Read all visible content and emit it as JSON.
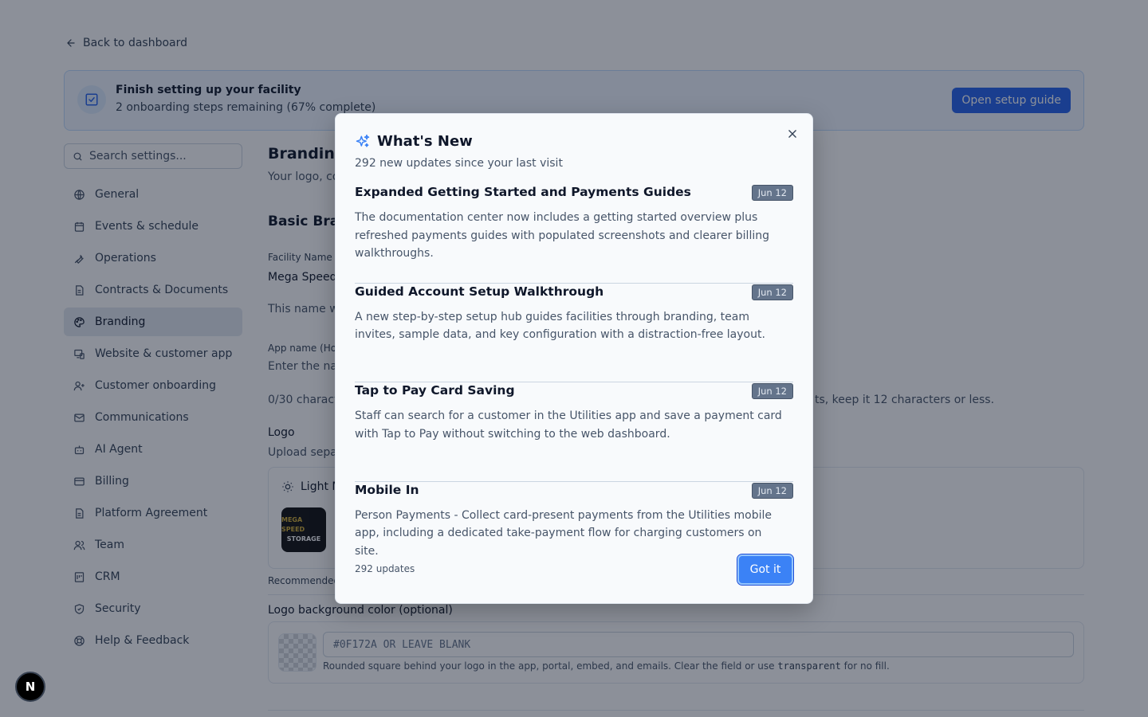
{
  "back_link": "Back to dashboard",
  "setup_banner": {
    "title": "Finish setting up your facility",
    "subtitle": "2 onboarding steps remaining (67% complete)",
    "button": "Open setup guide"
  },
  "search": {
    "placeholder": "Search settings..."
  },
  "sidebar": {
    "items": [
      {
        "label": "General",
        "icon": "globe-icon"
      },
      {
        "label": "Events & schedule",
        "icon": "calendar-icon"
      },
      {
        "label": "Operations",
        "icon": "wrench-icon"
      },
      {
        "label": "Contracts & Documents",
        "icon": "document-icon"
      },
      {
        "label": "Branding",
        "icon": "palette-icon",
        "active": true
      },
      {
        "label": "Website & customer app",
        "icon": "devices-icon"
      },
      {
        "label": "Customer onboarding",
        "icon": "user-plus-icon"
      },
      {
        "label": "Communications",
        "icon": "mail-icon"
      },
      {
        "label": "AI Agent",
        "icon": "bot-icon"
      },
      {
        "label": "Billing",
        "icon": "credit-card-icon"
      },
      {
        "label": "Platform Agreement",
        "icon": "document-icon"
      },
      {
        "label": "Team",
        "icon": "users-icon"
      },
      {
        "label": "CRM",
        "icon": "crm-icon"
      },
      {
        "label": "Security",
        "icon": "shield-icon"
      },
      {
        "label": "Help & Feedback",
        "icon": "lifebuoy-icon"
      }
    ]
  },
  "content": {
    "title": "Branding",
    "subtitle": "Your logo, co",
    "section_title": "Basic Bra",
    "facility_name_label": "Facility Name",
    "facility_name_value": "Mega Speed",
    "facility_name_help": "This name w",
    "app_name_label": "App name (Hor",
    "app_name_placeholder": "Enter the nar",
    "char_count": "0/30 characte",
    "char_count_right": "ts, keep it 12 characters or less.",
    "logo_label": "Logo",
    "logo_help": "Upload sepa",
    "logo_mode": "Light M",
    "logo_text_line1": "MEGA SPEED",
    "logo_text_line2": "STORAGE",
    "recommended": "Recommended",
    "bg_color_label": "Logo background color (optional)",
    "bg_color_placeholder": "#0F172A OR LEAVE BLANK",
    "bg_color_help_prefix": "Rounded square behind your logo in the app, portal, embed, and emails. Clear the field or use ",
    "bg_color_help_code": "transparent",
    "bg_color_help_suffix": " for no fill."
  },
  "modal": {
    "title": "What's New",
    "subtitle": "292 new updates since your last visit",
    "updates": [
      {
        "title": "Expanded Getting Started and Payments Guides",
        "date": "Jun 12",
        "body": "The documentation center now includes a getting started overview plus refreshed payments guides with populated screenshots and clearer billing walkthroughs."
      },
      {
        "title": "Guided Account Setup Walkthrough",
        "date": "Jun 12",
        "body": "A new step-by-step setup hub guides facilities through branding, team invites, sample data, and key configuration with a distraction-free layout."
      },
      {
        "title": "Tap to Pay Card Saving",
        "date": "Jun 12",
        "body": "Staff can search for a customer in the Utilities app and save a payment card with Tap to Pay without switching to the web dashboard."
      },
      {
        "title": "Mobile In",
        "date": "Jun 12",
        "body": "Person Payments - Collect card-present payments from the Utilities mobile app, including a dedicated take-payment flow for charging customers on site."
      }
    ],
    "count": "292 updates",
    "button": "Got it"
  },
  "nextjs_badge": "N",
  "colors": {
    "primary": "#2563eb",
    "overlay": "rgba(15,23,42,0.48)",
    "date_badge": "#64748b"
  }
}
